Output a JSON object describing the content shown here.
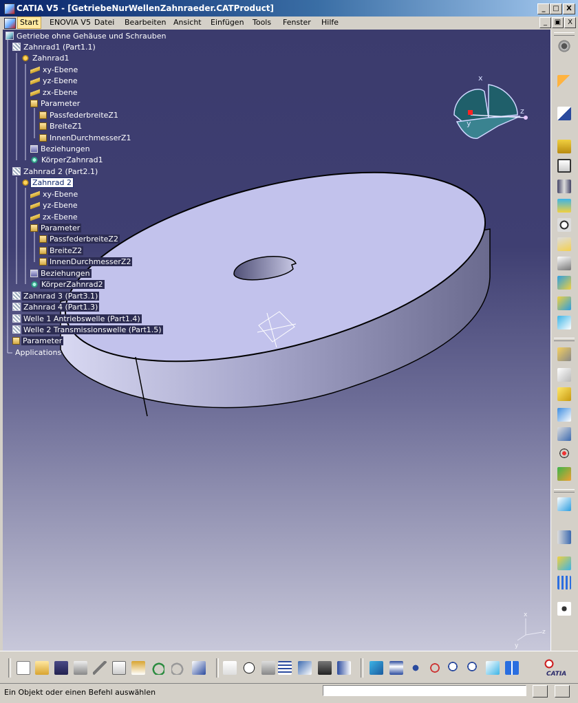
{
  "window": {
    "title": "CATIA V5 - [GetriebeNurWellenZahnraeder.CATProduct]",
    "controls": [
      "_",
      "□",
      "X"
    ]
  },
  "menubar": {
    "items": [
      {
        "label": "Start",
        "active": true
      },
      {
        "label": "ENOVIA V5"
      },
      {
        "label": "Datei"
      },
      {
        "label": "Bearbeiten"
      },
      {
        "label": "Ansicht"
      },
      {
        "label": "Einfügen"
      },
      {
        "label": "Tools"
      },
      {
        "label": "Fenster"
      },
      {
        "label": "Hilfe"
      }
    ],
    "doc_controls": [
      "_",
      "▣",
      "X"
    ]
  },
  "tree": {
    "root": "Getriebe ohne Gehäuse und Schrauben",
    "zahnrad1": {
      "label": "Zahnrad1 (Part1.1)",
      "part": "Zahnrad1",
      "xy": "xy-Ebene",
      "yz": "yz-Ebene",
      "zx": "zx-Ebene",
      "params": "Parameter",
      "p1": "PassfederbreiteZ1",
      "p2": "BreiteZ1",
      "p3": "InnenDurchmesserZ1",
      "rel": "Beziehungen",
      "body": "KörperZahnrad1"
    },
    "zahnrad2": {
      "label": "Zahnrad 2 (Part2.1)",
      "part": "Zahnrad 2",
      "xy": "xy-Ebene",
      "yz": "yz-Ebene",
      "zx": "zx-Ebene",
      "params": "Parameter",
      "p1": "PassfederbreiteZ2",
      "p2": "BreiteZ2",
      "p3": "InnenDurchmesserZ2",
      "rel": "Beziehungen",
      "body": "KörperZahnrad2"
    },
    "zahnrad3": "Zahnrad 3 (Part3.1)",
    "zahnrad4": "Zahnrad 4 (Part1.3)",
    "welle1": "Welle 1 Antriebswelle (Part1.4)",
    "welle2": "Welle 2 Transmissionswelle (Part1.5)",
    "parameter": "Parameter",
    "applications": "Applications"
  },
  "compass": {
    "x": "x",
    "y": "y",
    "z": "z"
  },
  "axis_triad": {
    "x": "x",
    "y": "y",
    "z": "z"
  },
  "statusbar": {
    "message": "Ein Objekt oder einen Befehl auswählen",
    "command_value": ""
  },
  "logo": {
    "text": "CATIA"
  },
  "colors": {
    "selection": "#0a246a",
    "viewport_top": "#3b3b6d",
    "viewport_bottom": "#c8c8da",
    "part_face": "#c0c0ec"
  },
  "toolbars": {
    "right_icons": [
      "sketcher-icon",
      "select-icon",
      "sketch-icon",
      "pad-icon",
      "pocket-icon",
      "shaft-icon",
      "groove-icon",
      "hole-icon",
      "rib-icon",
      "slot-icon",
      "stiffener-icon",
      "multi-section-icon",
      "removed-multi-section-icon",
      "edge-fillet-icon",
      "chamfer-icon",
      "draft-icon",
      "shell-icon",
      "thickness-icon",
      "thread-icon",
      "measure-icon",
      "axis-system-icon",
      "constraint-icon",
      "apply-material-icon",
      "pattern-icon",
      "reference-icon",
      "analysis-icon"
    ],
    "bottom_icons": [
      "new-icon",
      "open-icon",
      "save-icon",
      "print-icon",
      "cut-icon",
      "copy-icon",
      "paste-icon",
      "undo-icon",
      "redo-icon",
      "whats-this-icon",
      "formula-icon",
      "comment-icon",
      "knowledge-icon",
      "table-icon",
      "graph-tree-icon",
      "catalog-icon",
      "dimension-icon",
      "fly-mode-icon",
      "fit-all-icon",
      "pan-icon",
      "rotate-icon",
      "zoom-in-icon",
      "zoom-out-icon",
      "normal-view-icon",
      "multi-view-icon"
    ]
  }
}
